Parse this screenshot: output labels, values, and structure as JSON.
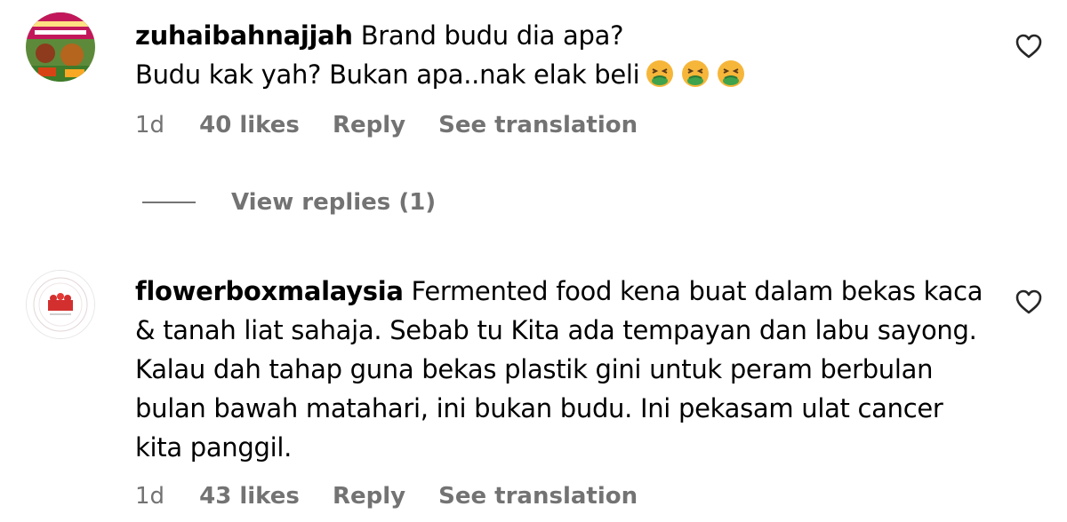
{
  "comments": [
    {
      "username": "zuhaibahnajjah",
      "text_line1": "Brand budu dia apa?",
      "text_line2": "Budu kak yah? Bukan apa..nak elak beli",
      "emojis": [
        "nauseated-face",
        "nauseated-face",
        "nauseated-face"
      ],
      "age": "1d",
      "likes": "40 likes",
      "reply": "Reply",
      "translate": "See translation",
      "view_replies": "View replies (1)"
    },
    {
      "username": "flowerboxmalaysia",
      "text": "Fermented food kena buat dalam bekas kaca & tanah liat sahaja. Sebab tu Kita ada tempayan dan labu sayong. Kalau dah tahap guna bekas plastik gini untuk peram berbulan bulan bawah matahari, ini bukan budu. Ini pekasam ulat cancer kita panggil.",
      "age": "1d",
      "likes": "43 likes",
      "reply": "Reply",
      "translate": "See translation"
    }
  ],
  "colors": {
    "meta_text": "#737373",
    "body_text": "#000000",
    "background": "#ffffff"
  },
  "icons": {
    "like": "heart-outline-icon",
    "emoji": "nauseated-face"
  }
}
